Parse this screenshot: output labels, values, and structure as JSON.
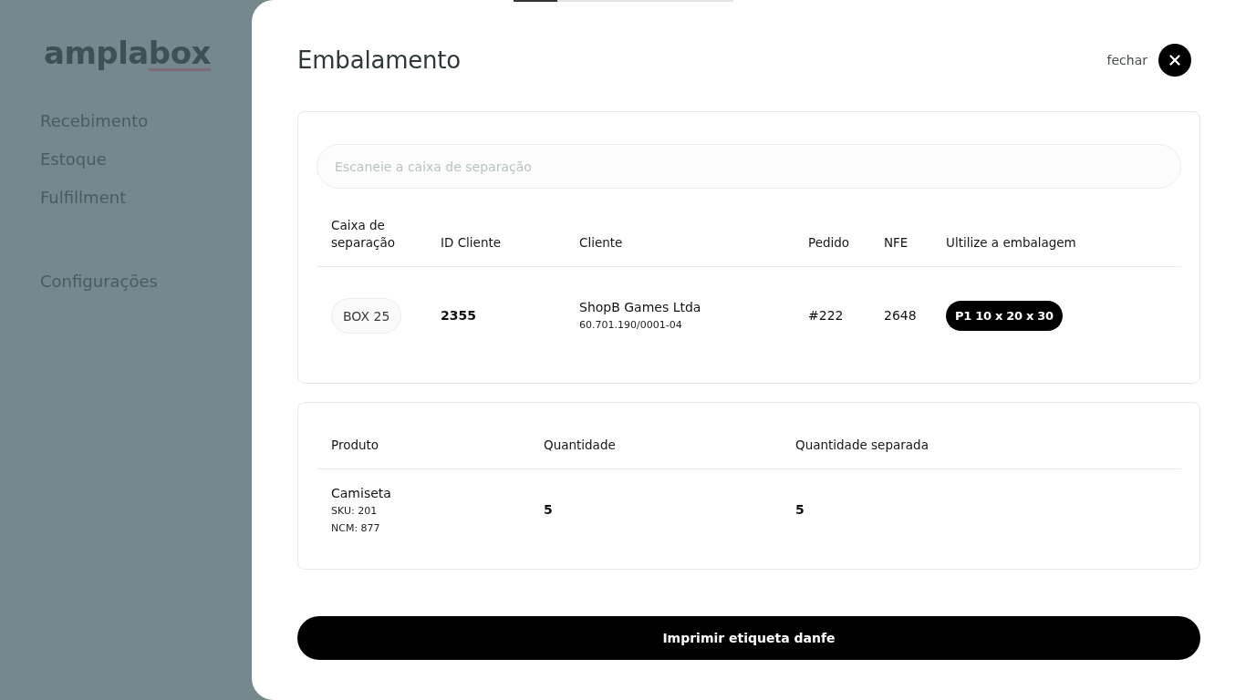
{
  "sidebar": {
    "logo": {
      "text": "ampla",
      "underlined_text": "box"
    },
    "groups": [
      {
        "items": [
          {
            "label": "Recebimento",
            "selected": false
          },
          {
            "label": "Estoque",
            "selected": false
          },
          {
            "label": "Fulfillment",
            "selected": false
          }
        ]
      },
      {
        "items": [
          {
            "label": "Configurações",
            "selected": false
          }
        ]
      }
    ]
  },
  "progress": {
    "level": 0.2
  },
  "modal": {
    "title": "Embalamento",
    "close_label": "fechar",
    "search": {
      "placeholder": "Escaneie a caixa de separação"
    },
    "order_table": {
      "columns": [
        "Caixa de separação",
        "ID Cliente",
        "Cliente",
        "Pedido",
        "NFE",
        "Ultilize a embalagem"
      ],
      "rows": [
        {
          "cells": [
            {
              "kind": "tag",
              "text": "BOX 25"
            },
            {
              "kind": "strong",
              "text": "2355"
            },
            {
              "kind": "stacked",
              "text": "ShopB Games Ltda",
              "details": [
                "60.701.190/0001-04"
              ]
            },
            {
              "kind": "text",
              "text": "#222"
            },
            {
              "kind": "text",
              "text": "2648"
            },
            {
              "kind": "badge",
              "text": "P1 10 x 20 x 30"
            }
          ]
        }
      ]
    },
    "product_table": {
      "columns": [
        "Produto",
        "Quantidade",
        "Quantidade separada"
      ],
      "rows": [
        {
          "cells": [
            {
              "kind": "stacked",
              "text": "Camiseta",
              "details": [
                "SKU: 201",
                "NCM: 877"
              ]
            },
            {
              "kind": "strong",
              "text": "5"
            },
            {
              "kind": "strong",
              "text": "5"
            }
          ]
        }
      ]
    },
    "print_button": "Imprimir etiqueta danfe"
  }
}
